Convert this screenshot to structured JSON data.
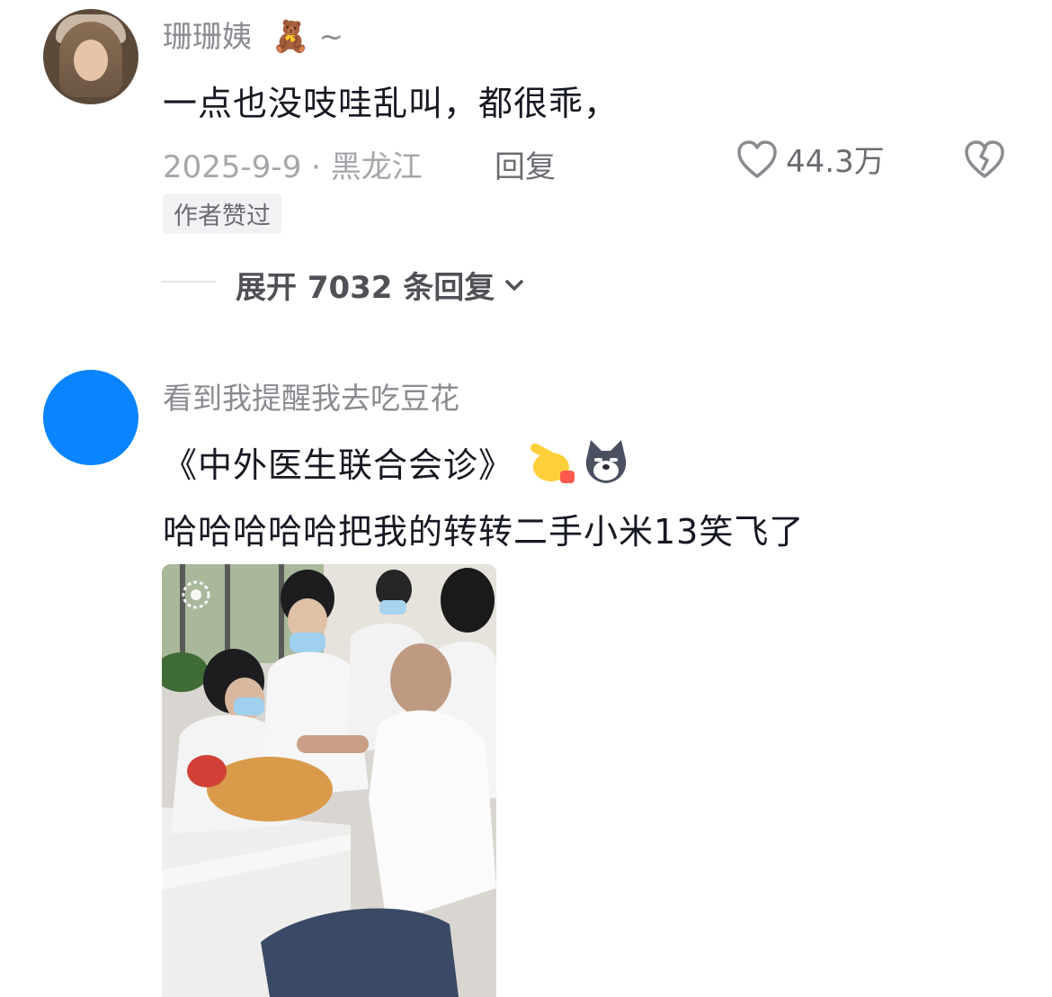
{
  "comments": [
    {
      "username": "珊珊姨",
      "username_suffix": "~",
      "text": "一点也没吱哇乱叫，都很乖，",
      "date_location": "2025-9-9 · 黑龙江",
      "reply_label": "回复",
      "like_count": "44.3万",
      "badge": "作者赞过",
      "expand_label": "展开 7032 条回复"
    },
    {
      "username": "看到我提醒我去吃豆花",
      "line1": "《中外医生联合会诊》",
      "line2": "哈哈哈哈哈把我的转转二手小米13笑飞了"
    }
  ],
  "icons": {
    "username_emoji": "teddy-bear-icon",
    "like": "heart-outline-icon",
    "dislike": "broken-heart-icon",
    "expand": "chevron-down-icon",
    "emoji1": "pointing-hand-icon",
    "emoji2": "husky-dog-icon"
  },
  "colors": {
    "avatar2": "#0a84ff",
    "text_primary": "#161823",
    "text_secondary": "#8a8b91"
  }
}
